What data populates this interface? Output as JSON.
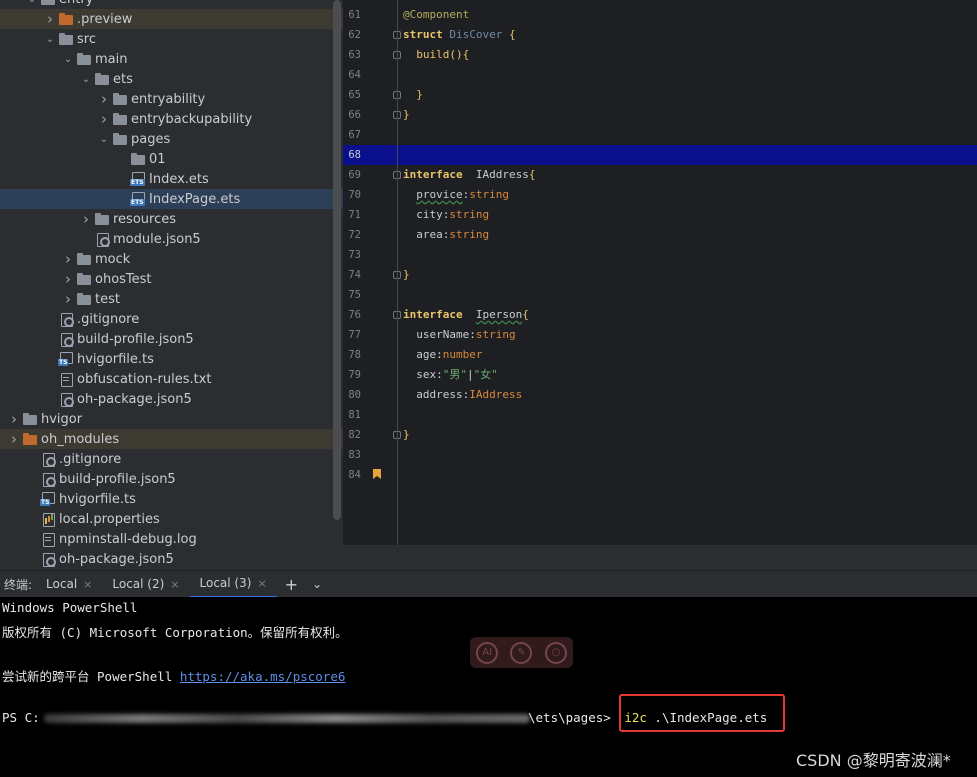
{
  "tree": {
    "items": [
      {
        "label": "entry",
        "indent": 2,
        "arrow": "open",
        "icon": "folder"
      },
      {
        "label": ".preview",
        "indent": 3,
        "arrow": "closed",
        "icon": "folder orange",
        "hl": true
      },
      {
        "label": "src",
        "indent": 3,
        "arrow": "open",
        "icon": "folder"
      },
      {
        "label": "main",
        "indent": 4,
        "arrow": "open",
        "icon": "folder"
      },
      {
        "label": "ets",
        "indent": 5,
        "arrow": "open",
        "icon": "folder"
      },
      {
        "label": "entryability",
        "indent": 6,
        "arrow": "closed",
        "icon": "folder"
      },
      {
        "label": "entrybackupability",
        "indent": 6,
        "arrow": "closed",
        "icon": "folder"
      },
      {
        "label": "pages",
        "indent": 6,
        "arrow": "open",
        "icon": "folder"
      },
      {
        "label": "01",
        "indent": 7,
        "arrow": "",
        "icon": "folder"
      },
      {
        "label": "Index.ets",
        "indent": 7,
        "arrow": "",
        "icon": "ets"
      },
      {
        "label": "IndexPage.ets",
        "indent": 7,
        "arrow": "",
        "icon": "ets",
        "sel": true
      },
      {
        "label": "resources",
        "indent": 5,
        "arrow": "closed",
        "icon": "folder"
      },
      {
        "label": "module.json5",
        "indent": 5,
        "arrow": "",
        "icon": "cfg"
      },
      {
        "label": "mock",
        "indent": 4,
        "arrow": "closed",
        "icon": "folder"
      },
      {
        "label": "ohosTest",
        "indent": 4,
        "arrow": "closed",
        "icon": "folder"
      },
      {
        "label": "test",
        "indent": 4,
        "arrow": "closed",
        "icon": "folder"
      },
      {
        "label": ".gitignore",
        "indent": 3,
        "arrow": "",
        "icon": "cfg"
      },
      {
        "label": "build-profile.json5",
        "indent": 3,
        "arrow": "",
        "icon": "cfg"
      },
      {
        "label": "hvigorfile.ts",
        "indent": 3,
        "arrow": "",
        "icon": "ts"
      },
      {
        "label": "obfuscation-rules.txt",
        "indent": 3,
        "arrow": "",
        "icon": "file"
      },
      {
        "label": "oh-package.json5",
        "indent": 3,
        "arrow": "",
        "icon": "cfg"
      },
      {
        "label": "hvigor",
        "indent": 1,
        "arrow": "closed",
        "icon": "folder"
      },
      {
        "label": "oh_modules",
        "indent": 1,
        "arrow": "closed",
        "icon": "folder orange",
        "hl": true
      },
      {
        "label": ".gitignore",
        "indent": 2,
        "arrow": "",
        "icon": "cfg"
      },
      {
        "label": "build-profile.json5",
        "indent": 2,
        "arrow": "",
        "icon": "cfg"
      },
      {
        "label": "hvigorfile.ts",
        "indent": 2,
        "arrow": "",
        "icon": "ts"
      },
      {
        "label": "local.properties",
        "indent": 2,
        "arrow": "",
        "icon": "props"
      },
      {
        "label": "npminstall-debug.log",
        "indent": 2,
        "arrow": "",
        "icon": "file"
      },
      {
        "label": "oh-package.json5",
        "indent": 2,
        "arrow": "",
        "icon": "cfg"
      }
    ]
  },
  "editor": {
    "current_line": "68",
    "lines": [
      {
        "num": "61",
        "tokens": [
          {
            "t": "@Component",
            "c": "ann"
          }
        ]
      },
      {
        "num": "62",
        "tokens": [
          {
            "t": "struct ",
            "c": "kw"
          },
          {
            "t": "DisCover ",
            "c": "cls"
          },
          {
            "t": "{",
            "c": "brace"
          }
        ]
      },
      {
        "num": "63",
        "tokens": [
          {
            "t": "  build",
            "c": "fn"
          },
          {
            "t": "(){",
            "c": "brace"
          }
        ]
      },
      {
        "num": "64",
        "tokens": []
      },
      {
        "num": "65",
        "tokens": [
          {
            "t": "  }",
            "c": "brace"
          }
        ]
      },
      {
        "num": "66",
        "tokens": [
          {
            "t": "}",
            "c": "brace"
          }
        ]
      },
      {
        "num": "67",
        "tokens": []
      },
      {
        "num": "68",
        "tokens": []
      },
      {
        "num": "69",
        "tokens": [
          {
            "t": "interface ",
            "c": "kw"
          },
          {
            "t": " IAddress",
            "c": "prop"
          },
          {
            "t": "{",
            "c": "brace"
          }
        ]
      },
      {
        "num": "70",
        "tokens": [
          {
            "t": "  ",
            "c": "prop"
          },
          {
            "t": "provice",
            "c": "prop sq"
          },
          {
            "t": ":",
            "c": "prop"
          },
          {
            "t": "string",
            "c": "type"
          }
        ]
      },
      {
        "num": "71",
        "tokens": [
          {
            "t": "  city:",
            "c": "prop"
          },
          {
            "t": "string",
            "c": "type"
          }
        ]
      },
      {
        "num": "72",
        "tokens": [
          {
            "t": "  area:",
            "c": "prop"
          },
          {
            "t": "string",
            "c": "type"
          }
        ]
      },
      {
        "num": "73",
        "tokens": []
      },
      {
        "num": "74",
        "tokens": [
          {
            "t": "}",
            "c": "brace"
          }
        ]
      },
      {
        "num": "75",
        "tokens": []
      },
      {
        "num": "76",
        "tokens": [
          {
            "t": "interface ",
            "c": "kw"
          },
          {
            "t": " ",
            "c": "prop"
          },
          {
            "t": "Iperson",
            "c": "prop sq"
          },
          {
            "t": "{",
            "c": "brace"
          }
        ]
      },
      {
        "num": "77",
        "tokens": [
          {
            "t": "  userName:",
            "c": "prop"
          },
          {
            "t": "string",
            "c": "type"
          }
        ]
      },
      {
        "num": "78",
        "tokens": [
          {
            "t": "  age:",
            "c": "prop"
          },
          {
            "t": "number",
            "c": "type"
          }
        ]
      },
      {
        "num": "79",
        "tokens": [
          {
            "t": "  sex:",
            "c": "prop"
          },
          {
            "t": "\"男\"",
            "c": "str"
          },
          {
            "t": "|",
            "c": "prop"
          },
          {
            "t": "\"女\"",
            "c": "str"
          }
        ]
      },
      {
        "num": "80",
        "tokens": [
          {
            "t": "  address:",
            "c": "prop"
          },
          {
            "t": "IAddress",
            "c": "type"
          }
        ]
      },
      {
        "num": "81",
        "tokens": []
      },
      {
        "num": "82",
        "tokens": [
          {
            "t": "}",
            "c": "brace"
          }
        ]
      },
      {
        "num": "83",
        "tokens": []
      },
      {
        "num": "84",
        "tokens": []
      }
    ]
  },
  "terminal": {
    "title": "终端:",
    "tabs": [
      {
        "label": "Local",
        "active": false
      },
      {
        "label": "Local (2)",
        "active": false
      },
      {
        "label": "Local (3)",
        "active": true
      }
    ],
    "add_icon": "+",
    "more_icon": "⌄",
    "lines": {
      "l1": "Windows PowerShell",
      "l2": "版权所有 (C) Microsoft Corporation。保留所有权利。",
      "l3_prefix": "尝试新的跨平台 PowerShell ",
      "l3_link": "https://aka.ms/pscore6",
      "prompt_start": "PS C:",
      "prompt_end": "\\ets\\pages> ",
      "cmd_name": "i2c",
      "cmd_arg": " .\\IndexPage.ets"
    },
    "float_tools": [
      "AI",
      "✎",
      "○"
    ]
  },
  "watermark": "CSDN @黎明寄波澜*"
}
